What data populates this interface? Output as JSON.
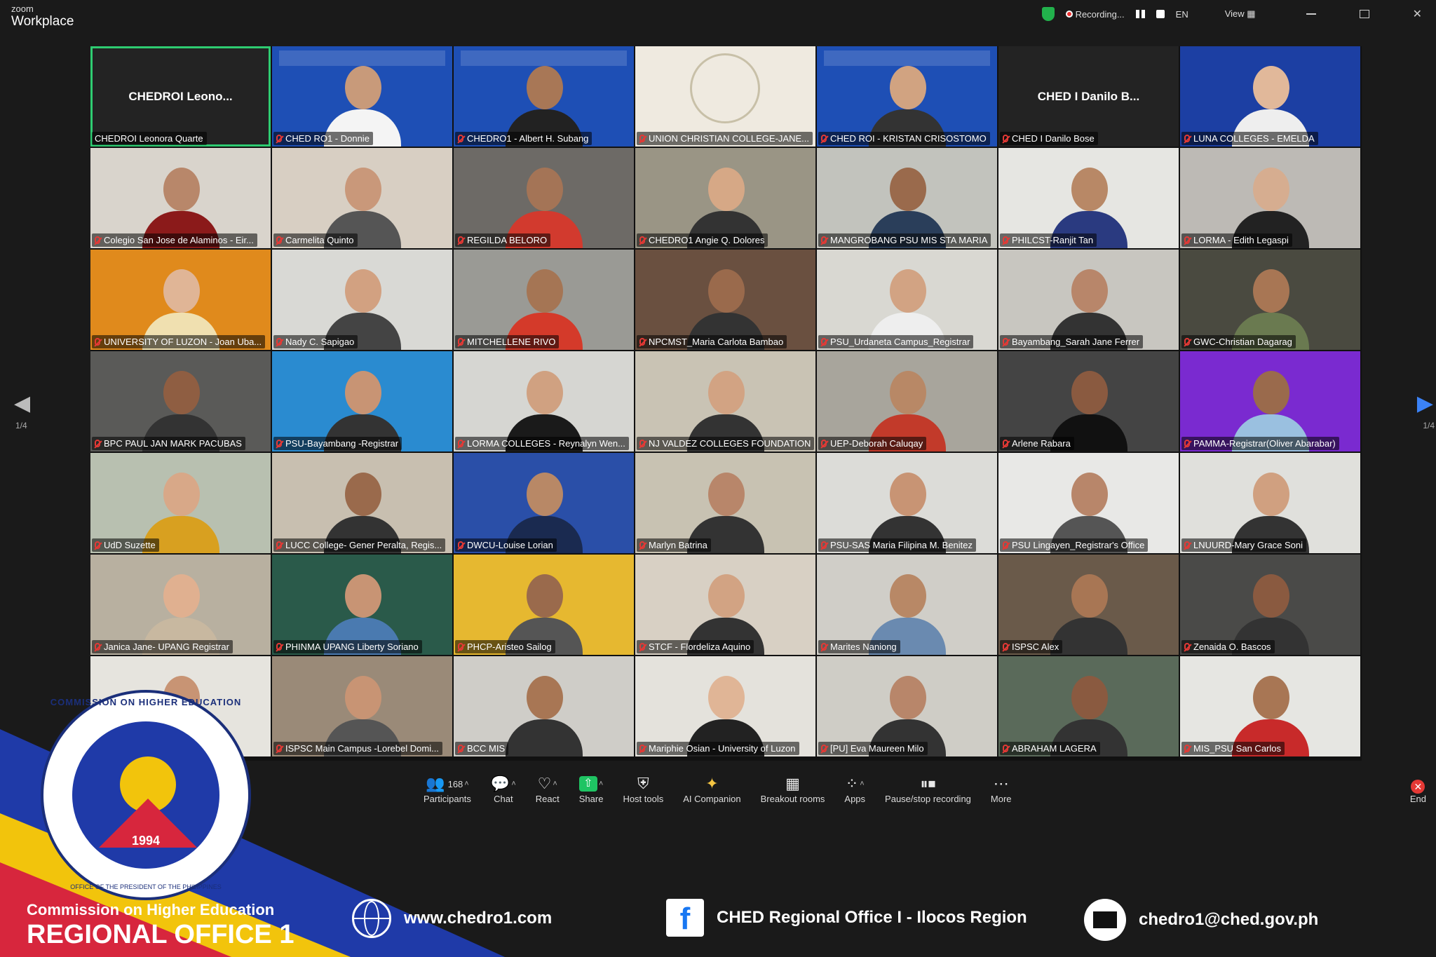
{
  "app": {
    "logo_top": "zoom",
    "logo_bottom": "Workplace"
  },
  "status": {
    "recording": "Recording...",
    "lang": "EN",
    "view": "View"
  },
  "page_left": "1/4",
  "page_right": "1/4",
  "tiles": [
    {
      "name": "CHEDROI Leonora Quarte",
      "label": "CHEDROI  Leono...",
      "type": "name",
      "active": true
    },
    {
      "name": "CHED RO1 - Donnie",
      "type": "video",
      "bg": "#1e4fb5",
      "skin": "#c89a7a",
      "shirt": "#f4f4f4",
      "banner": true
    },
    {
      "name": "CHEDRO1 - Albert H. Subang",
      "type": "video",
      "bg": "#1e4fb5",
      "skin": "#a87756",
      "shirt": "#222",
      "banner": true
    },
    {
      "name": "UNION CHRISTIAN COLLEGE-JANE...",
      "type": "logo",
      "bg": "#efeae0"
    },
    {
      "name": "CHED ROI - KRISTAN CRISOSTOMO",
      "type": "video",
      "bg": "#1e4fb5",
      "skin": "#d1a381",
      "shirt": "#333",
      "banner": true
    },
    {
      "name": "CHED I Danilo Bose",
      "label": "CHED I Danilo B...",
      "type": "name"
    },
    {
      "name": "LUNA COLLEGES - EMELDA",
      "type": "video",
      "bg": "#1c3fa3",
      "skin": "#e1b89a",
      "shirt": "#eee"
    },
    {
      "name": "Colegio San Jose de Alaminos - Eir...",
      "type": "video",
      "bg": "#d9d4cc",
      "skin": "#b8876a",
      "shirt": "#8b1a1a"
    },
    {
      "name": "Carmelita Quinto",
      "type": "video",
      "bg": "#d8cfc3",
      "skin": "#c9987a",
      "shirt": "#555"
    },
    {
      "name": "REGILDA BELORO",
      "type": "video",
      "bg": "#6d6a66",
      "skin": "#a47456",
      "shirt": "#d23a2e"
    },
    {
      "name": "CHEDRO1 Angie Q. Dolores",
      "type": "video",
      "bg": "#9a9585",
      "skin": "#d6a886",
      "shirt": "#333"
    },
    {
      "name": "MANGROBANG PSU MIS STA MARIA",
      "type": "video",
      "bg": "#c2c3bd",
      "skin": "#9a6a4c",
      "shirt": "#2a3e5a"
    },
    {
      "name": "PHILCST-Ranjit Tan",
      "type": "video",
      "bg": "#e6e6e2",
      "skin": "#b88866",
      "shirt": "#2a3a80"
    },
    {
      "name": "LORMA - Edith Legaspi",
      "type": "video",
      "bg": "#bdbab5",
      "skin": "#d6ad90",
      "shirt": "#222"
    },
    {
      "name": "UNIVERSITY OF LUZON - Joan Uba...",
      "type": "video",
      "bg": "#e08a1c",
      "skin": "#e0b596",
      "shirt": "#f0e0b0"
    },
    {
      "name": "Nady C. Sapigao",
      "type": "video",
      "bg": "#d9d9d5",
      "skin": "#d2a181",
      "shirt": "#444"
    },
    {
      "name": "MITCHELLENE RIVO",
      "type": "video",
      "bg": "#9a9a95",
      "skin": "#a57554",
      "shirt": "#d43a2a"
    },
    {
      "name": "NPCMST_Maria Carlota Bambao",
      "type": "video",
      "bg": "#6a5040",
      "skin": "#9a6a4c",
      "shirt": "#333"
    },
    {
      "name": "PSU_Urdaneta Campus_Registrar",
      "type": "video",
      "bg": "#d9d8d2",
      "skin": "#d2a383",
      "shirt": "#eee"
    },
    {
      "name": "Bayambang_Sarah Jane Ferrer",
      "type": "video",
      "bg": "#c8c6c0",
      "skin": "#b8866a",
      "shirt": "#333"
    },
    {
      "name": "GWC-Christian Dagarag",
      "type": "video",
      "bg": "#4a4a40",
      "skin": "#a87654",
      "shirt": "#6a7a50"
    },
    {
      "name": "BPC PAUL JAN MARK PACUBAS",
      "type": "video",
      "bg": "#5a5a58",
      "skin": "#8f5e42",
      "shirt": "#333"
    },
    {
      "name": "PSU-Bayambang -Registrar",
      "type": "video",
      "bg": "#2a8bd0",
      "skin": "#c89474",
      "shirt": "#333"
    },
    {
      "name": "LORMA COLLEGES - Reynalyn Wen...",
      "type": "video",
      "bg": "#d6d6d2",
      "skin": "#d0a181",
      "shirt": "#1a1a1a"
    },
    {
      "name": "NJ VALDEZ COLLEGES FOUNDATION",
      "type": "video",
      "bg": "#c9c3b4",
      "skin": "#d2a383",
      "shirt": "#333"
    },
    {
      "name": "UEP-Deborah Caluqay",
      "type": "video",
      "bg": "#a8a59c",
      "skin": "#b88866",
      "shirt": "#c23a2a"
    },
    {
      "name": "Arlene Rabara",
      "type": "video",
      "bg": "#444",
      "skin": "#8a5a40",
      "shirt": "#111"
    },
    {
      "name": "PAMMA-Registrar(Oliver Abarabar)",
      "type": "video",
      "bg": "#7a2ad0",
      "skin": "#9a6a4c",
      "shirt": "#9ac0e0"
    },
    {
      "name": "UdD Suzette",
      "type": "video",
      "bg": "#b8c0b0",
      "skin": "#d8a888",
      "shirt": "#d8a020"
    },
    {
      "name": "LUCC College- Gener Peralta, Regis...",
      "type": "video",
      "bg": "#c8bfb0",
      "skin": "#9a6a4c",
      "shirt": "#333"
    },
    {
      "name": "DWCU-Louise Lorian",
      "type": "video",
      "bg": "#2a4fa8",
      "skin": "#b88866",
      "shirt": "#1a2a50"
    },
    {
      "name": "Marlyn Batrina",
      "type": "video",
      "bg": "#c8c2b2",
      "skin": "#b8866a",
      "shirt": "#333"
    },
    {
      "name": "PSU-SAS Maria Filipina M. Benitez",
      "type": "video",
      "bg": "#dcdcd8",
      "skin": "#c89474",
      "shirt": "#333"
    },
    {
      "name": "PSU Lingayen_Registrar's Office",
      "type": "video",
      "bg": "#e8e8e6",
      "skin": "#b8866a",
      "shirt": "#555"
    },
    {
      "name": "LNUURD-Mary Grace Soni",
      "type": "video",
      "bg": "#e0e0dc",
      "skin": "#d0a080",
      "shirt": "#333"
    },
    {
      "name": "Janica Jane- UPANG Registrar",
      "type": "video",
      "bg": "#b8b0a0",
      "skin": "#e0b090",
      "shirt": "#c8b8a0"
    },
    {
      "name": "PHINMA UPANG Liberty Soriano",
      "type": "video",
      "bg": "#2a5a4a",
      "skin": "#c89474",
      "shirt": "#4a7ab0"
    },
    {
      "name": "PHCP-Aristeo Sailog",
      "type": "video",
      "bg": "#e6b830",
      "skin": "#9a6a4c",
      "shirt": "#555"
    },
    {
      "name": "STCF - Flordeliza Aquino",
      "type": "video",
      "bg": "#d8d0c4",
      "skin": "#d2a383",
      "shirt": "#333"
    },
    {
      "name": "Marites Naniong",
      "type": "video",
      "bg": "#d0cec8",
      "skin": "#b88866",
      "shirt": "#6a8ab0"
    },
    {
      "name": "ISPSC Alex",
      "type": "video",
      "bg": "#6a5a4a",
      "skin": "#a87654",
      "shirt": "#333"
    },
    {
      "name": "Zenaida O. Bascos",
      "type": "video",
      "bg": "#4a4a48",
      "skin": "#8a5a40",
      "shirt": "#333"
    },
    {
      "name": "",
      "type": "video",
      "bg": "#e6e4de",
      "skin": "#c89474",
      "shirt": "#555"
    },
    {
      "name": "ISPSC Main Campus -Lorebel Domi...",
      "type": "video",
      "bg": "#9a8a78",
      "skin": "#c89474",
      "shirt": "#555"
    },
    {
      "name": "BCC MIS",
      "type": "video",
      "bg": "#cfcdc8",
      "skin": "#a87654",
      "shirt": "#333"
    },
    {
      "name": "Mariphie Osian - University of Luzon",
      "type": "video",
      "bg": "#e4e2dc",
      "skin": "#e0b596",
      "shirt": "#222"
    },
    {
      "name": "[PU] Eva Maureen Milo",
      "type": "video",
      "bg": "#cfcdc6",
      "skin": "#b8866a",
      "shirt": "#333"
    },
    {
      "name": "ABRAHAM LAGERA",
      "type": "video",
      "bg": "#5a6a5a",
      "skin": "#8a5a40",
      "shirt": "#333"
    },
    {
      "name": "MIS_PSU San Carlos",
      "type": "video",
      "bg": "#e6e6e2",
      "skin": "#a87654",
      "shirt": "#c82a2a"
    }
  ],
  "toolbar": {
    "participants": {
      "label": "Participants",
      "count": "168"
    },
    "chat": "Chat",
    "react": "React",
    "share": "Share",
    "host_tools": "Host tools",
    "ai": "AI Companion",
    "breakout": "Breakout rooms",
    "apps": "Apps",
    "record": "Pause/stop recording",
    "more": "More",
    "end": "End"
  },
  "footer": {
    "seal_top": "COMMISSION ON HIGHER EDUCATION",
    "seal_year": "1994",
    "seal_bottom": "OFFICE OF THE PRESIDENT OF THE PHILIPPINES",
    "org_line1": "Commission on Higher Education",
    "org_line2": "REGIONAL OFFICE 1",
    "website": "www.chedro1.com",
    "facebook": "CHED Regional Office I - Ilocos Region",
    "email": "chedro1@ched.gov.ph"
  }
}
